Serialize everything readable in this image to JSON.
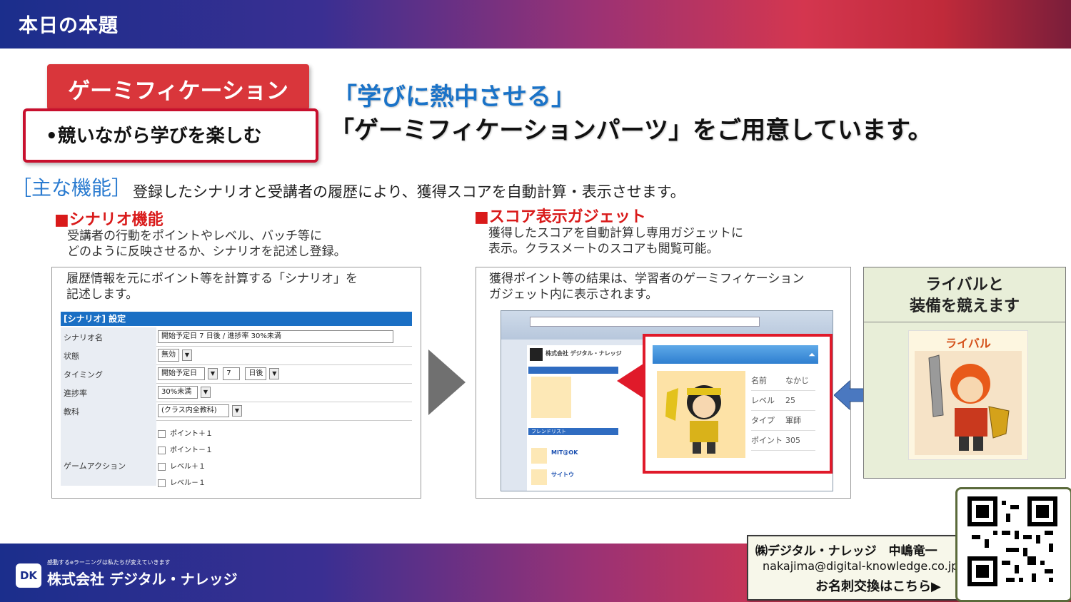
{
  "header": {
    "title": "本日の本題"
  },
  "gamification": {
    "tag": "ゲーミフィケーション",
    "bullet": "•競いながら学びを楽しむ"
  },
  "headline": {
    "line1": "「学びに熱中させる」",
    "line2": "「ゲーミフィケーションパーツ」をご用意しています。"
  },
  "features": {
    "label": "［主な機能］",
    "description": "登録したシナリオと受講者の履歴により、獲得スコアを自動計算・表示させます。"
  },
  "scenario": {
    "title": "■シナリオ機能",
    "body_line1": "受講者の行動をポイントやレベル、バッチ等に",
    "body_line2": "どのように反映させるか、シナリオを記述し登録。",
    "panel_line1": "履歴情報を元にポイント等を計算する「シナリオ」を",
    "panel_line2": "記述します。",
    "form": {
      "header": "[シナリオ] 設定",
      "rows": [
        {
          "label": "シナリオ名",
          "value": "開始予定日 7 日後 / 進捗率 30%未満"
        },
        {
          "label": "状態",
          "value": "無効"
        },
        {
          "label": "タイミング",
          "value": "開始予定日",
          "value2": "7",
          "value3": "日後"
        },
        {
          "label": "進捗率",
          "value": "30%未満"
        },
        {
          "label": "教科",
          "value": "(クラス内全教科)"
        },
        {
          "label": "ゲームアクション",
          "options": [
            "ポイント＋１",
            "ポイント－１",
            "レベル＋１",
            "レベル－１"
          ]
        }
      ]
    }
  },
  "score_gadget": {
    "title": "■スコア表示ガジェット",
    "body_line1": "獲得したスコアを自動計算し専用ガジェットに",
    "body_line2": "表示。クラスメートのスコアも閲覧可能。",
    "panel_line1": "獲得ポイント等の結果は、学習者のゲーミフィケーション",
    "panel_line2": "ガジェット内に表示されます。",
    "browser": {
      "company": "株式会社 デジタル・ナレッジ",
      "friend_list": "フレンドリスト",
      "friend1": "MIT@OK",
      "friend2": "サイトウ"
    },
    "popup": {
      "collapse": "⏶",
      "stats": [
        {
          "key": "名前",
          "value": "なかじ"
        },
        {
          "key": "レベル",
          "value": "25"
        },
        {
          "key": "タイプ",
          "value": "軍師"
        },
        {
          "key": "ポイント",
          "value": "305"
        }
      ]
    }
  },
  "rival": {
    "title_line1": "ライバルと",
    "title_line2": "装備を競えます",
    "badge": "ライバル"
  },
  "footer": {
    "tagline": "感動するeラーニングは私たちが変えていきます",
    "company": "株式会社 デジタル・ナレッジ",
    "logo_text": "DK"
  },
  "business_card": {
    "name": "㈱デジタル・ナレッジ　中嶋竜一",
    "email": "nakajima@digital-knowledge.co.jp",
    "cta": "お名刺交換はこちら▶"
  },
  "colors": {
    "accent_red": "#d9363b",
    "accent_blue": "#1a73c8"
  }
}
